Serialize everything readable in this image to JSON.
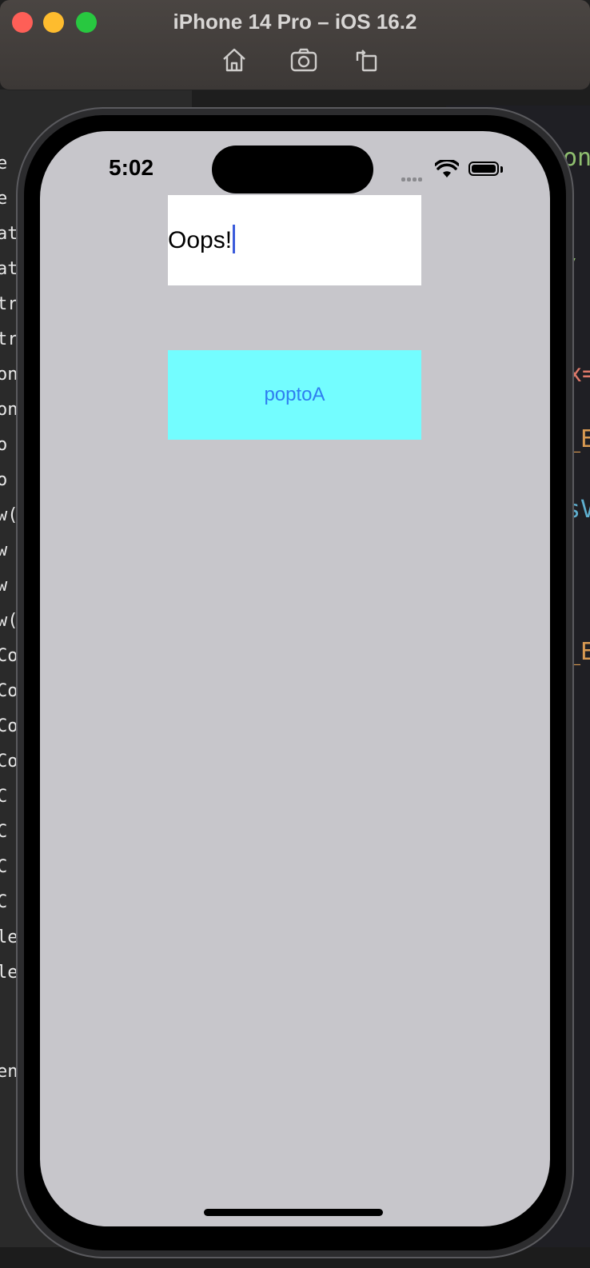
{
  "window": {
    "title": "iPhone 14 Pro – iOS 16.2",
    "toolbar": [
      "home-icon",
      "screenshot-icon",
      "rotate-icon"
    ]
  },
  "background": {
    "left_fragments": [
      "e",
      "e",
      "at",
      "at",
      "tro",
      "tr",
      "on",
      "on",
      "o",
      "o",
      "w(",
      "w",
      "w",
      "w(",
      "Co",
      "Co",
      "Co",
      "Co",
      "C",
      "C",
      "C",
      "C",
      "le",
      "le",
      "en"
    ],
    "right_fragments": [
      {
        "text": "ont",
        "color": "#8fbf6f"
      },
      {
        "text": "/",
        "color": "#8fbf6f"
      },
      {
        "text": "x=",
        "color": "#e07a6a"
      },
      {
        "text": "_E",
        "color": "#d99a52"
      },
      {
        "text": "sV",
        "color": "#5fb0d0"
      },
      {
        "text": "_E",
        "color": "#d99a52"
      }
    ]
  },
  "status_bar": {
    "time": "5:02"
  },
  "screen": {
    "text_field_value": "Oops!",
    "button_label": "poptoA"
  }
}
